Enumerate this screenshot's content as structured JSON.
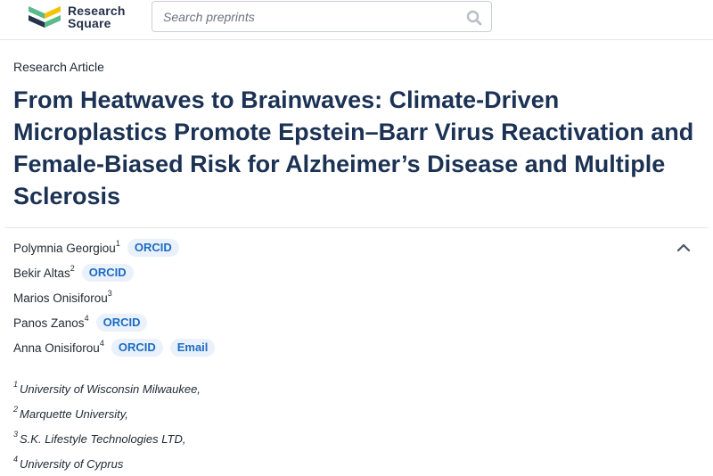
{
  "header": {
    "logo_line1": "Research",
    "logo_line2": "Square",
    "search_placeholder": "Search preprints",
    "brand_colors": {
      "logo_dark": "#24324a",
      "logo_green": "#5bb98b",
      "logo_yellow": "#f5c400"
    }
  },
  "article": {
    "type": "Research Article",
    "title": "From Heatwaves to Brainwaves: Climate-Driven Microplastics Promote Epstein–Barr Virus Reactivation and Female-Biased Risk for Alzheimer’s Disease and Multiple Sclerosis"
  },
  "authors": [
    {
      "name": "Polymnia Georgiou",
      "sup": "1",
      "orcid": "ORCID"
    },
    {
      "name": "Bekir Altas",
      "sup": "2",
      "orcid": "ORCID"
    },
    {
      "name": "Marios Onisiforou",
      "sup": "3"
    },
    {
      "name": "Panos Zanos",
      "sup": "4",
      "orcid": "ORCID"
    },
    {
      "name": "Anna Onisiforou",
      "sup": "4",
      "orcid": "ORCID",
      "email": "Email"
    }
  ],
  "affiliations": [
    {
      "num": "1",
      "text": "University of Wisconsin Milwaukee,"
    },
    {
      "num": "2",
      "text": "Marquette University,"
    },
    {
      "num": "3",
      "text": "S.K. Lifestyle Technologies LTD,"
    },
    {
      "num": "4",
      "text": "University of Cyprus"
    }
  ],
  "icons": {
    "search": "search-icon",
    "collapse": "chevron-up-icon"
  }
}
